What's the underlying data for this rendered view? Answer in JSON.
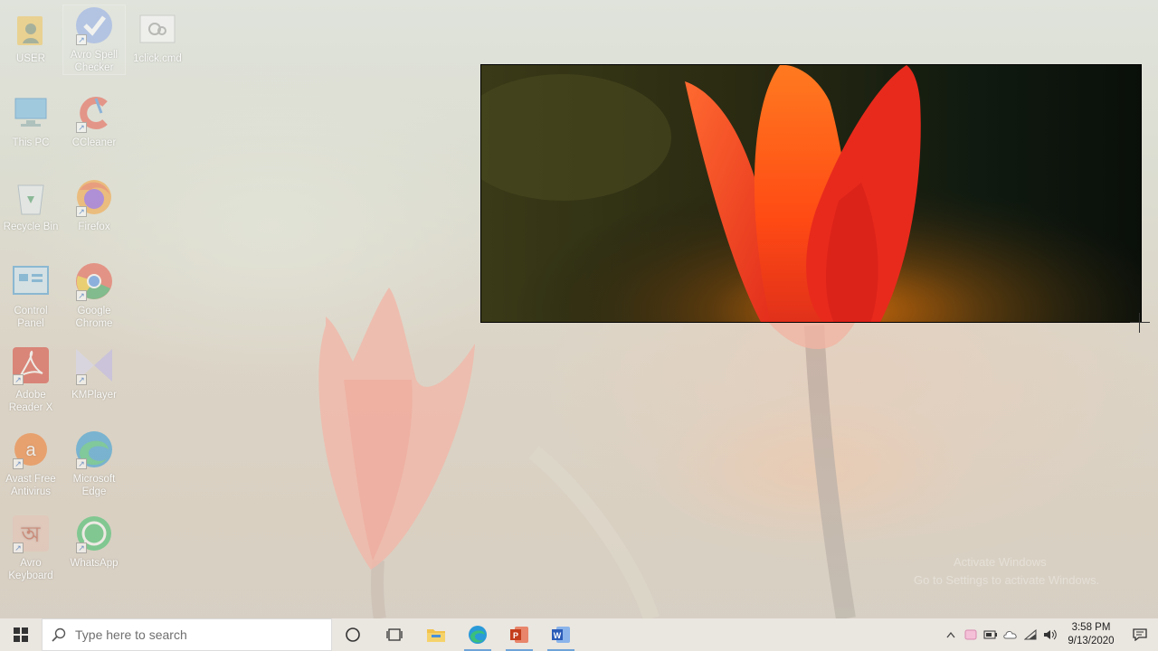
{
  "desktop": {
    "icons": [
      {
        "label": "USER",
        "icon": "user-folder-icon"
      },
      {
        "label": "Avro Spell Checker",
        "icon": "avro-spell-checker-icon"
      },
      {
        "label": "1click.cmd",
        "icon": "cmd-file-icon"
      },
      {
        "label": "This PC",
        "icon": "this-pc-icon"
      },
      {
        "label": "CCleaner",
        "icon": "ccleaner-icon"
      },
      {
        "label": "Recycle Bin",
        "icon": "recycle-bin-icon"
      },
      {
        "label": "Firefox",
        "icon": "firefox-icon"
      },
      {
        "label": "Control Panel",
        "icon": "control-panel-icon"
      },
      {
        "label": "Google Chrome",
        "icon": "chrome-icon"
      },
      {
        "label": "Adobe Reader X",
        "icon": "adobe-reader-icon"
      },
      {
        "label": "KMPlayer",
        "icon": "kmplayer-icon"
      },
      {
        "label": "Avast Free Antivirus",
        "icon": "avast-icon"
      },
      {
        "label": "Microsoft Edge",
        "icon": "edge-icon"
      },
      {
        "label": "Avro Keyboard",
        "icon": "avro-keyboard-icon"
      },
      {
        "label": "WhatsApp",
        "icon": "whatsapp-icon"
      }
    ],
    "watermark": {
      "line1": "Activate Windows",
      "line2": "Go to Settings to activate Windows."
    }
  },
  "taskbar": {
    "search_placeholder": "Type here to search",
    "apps": [
      "cortana-icon",
      "task-view-icon",
      "file-explorer-icon",
      "edge-icon",
      "powerpoint-icon",
      "word-icon"
    ],
    "time": "3:58 PM",
    "date": "9/13/2020"
  },
  "colors": {
    "accent": "#0078d7",
    "taskbar": "#ece8e2"
  }
}
